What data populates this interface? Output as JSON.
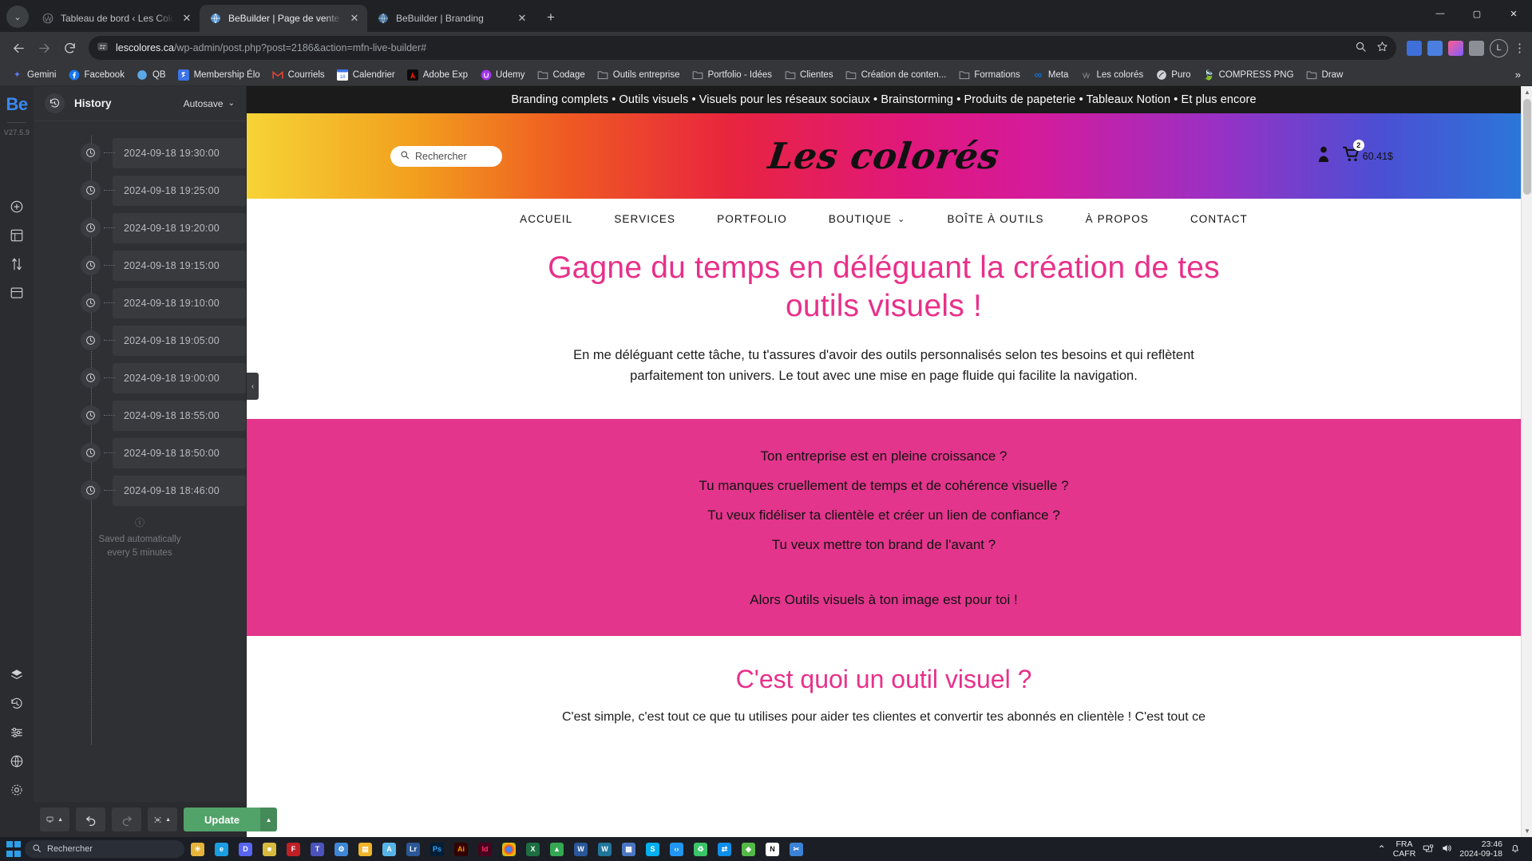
{
  "browser": {
    "tabs": [
      {
        "title": "Tableau de bord ‹ Les Colorés –",
        "favicon": "wordpress-icon",
        "active": false
      },
      {
        "title": "BeBuilder | Page de vente – Out",
        "favicon": "globe-icon",
        "active": true
      },
      {
        "title": "BeBuilder | Branding",
        "favicon": "globe-icon",
        "active": false
      }
    ],
    "newtab_label": "+",
    "tabdrop_label": "⌄",
    "window_controls": {
      "minimize": "—",
      "maximize": "▢",
      "close": "✕"
    },
    "nav": {
      "back": "←",
      "forward": "→",
      "reload": "⟳"
    },
    "omnibox": {
      "url_main": "lescolores.ca",
      "url_rest": "/wp-admin/post.php?post=2186&action=mfn-live-builder#",
      "site_info_icon": "page-settings-icon",
      "zoom_icon": "search-icon",
      "bookmark_icon": "star-icon"
    },
    "profile_initial": "L",
    "menu_icon": "⋮",
    "bookmarks": [
      {
        "label": "Gemini",
        "icon": "gemini-icon",
        "color": "#5b7cf5"
      },
      {
        "label": "Facebook",
        "icon": "facebook-icon",
        "color": "#1877f2"
      },
      {
        "label": "QB",
        "icon": "quickbooks-icon",
        "color": "#4da3e8"
      },
      {
        "label": "Membership Élo",
        "icon": "app-icon",
        "color": "#3b73e8"
      },
      {
        "label": "Courriels",
        "icon": "gmail-icon",
        "color": "#ea4335"
      },
      {
        "label": "Calendrier",
        "icon": "calendar-icon",
        "color": "#3b73e8"
      },
      {
        "label": "Adobe Exp",
        "icon": "adobe-icon",
        "color": "#fa0f00"
      },
      {
        "label": "Udemy",
        "icon": "udemy-icon",
        "color": "#a435f0"
      },
      {
        "label": "Codage",
        "icon": "folder-icon",
        "color": "#9aa0a6"
      },
      {
        "label": "Outils entreprise",
        "icon": "folder-icon",
        "color": "#9aa0a6"
      },
      {
        "label": "Portfolio - Idées",
        "icon": "folder-icon",
        "color": "#9aa0a6"
      },
      {
        "label": "Clientes",
        "icon": "folder-icon",
        "color": "#9aa0a6"
      },
      {
        "label": "Création de conten...",
        "icon": "folder-icon",
        "color": "#9aa0a6"
      },
      {
        "label": "Formations",
        "icon": "folder-icon",
        "color": "#9aa0a6"
      },
      {
        "label": "Meta",
        "icon": "meta-icon",
        "color": "#0082fb"
      },
      {
        "label": "Les colorés",
        "icon": "wordpress-icon",
        "color": "#8a8d91"
      },
      {
        "label": "Puro",
        "icon": "puro-icon",
        "color": "#cfd2d6"
      },
      {
        "label": "COMPRESS PNG",
        "icon": "tinypng-icon",
        "color": "#5ab9a8"
      },
      {
        "label": "Draw",
        "icon": "folder-icon",
        "color": "#9aa0a6"
      }
    ],
    "bookmarks_overflow": "»"
  },
  "builder": {
    "logo": "Be",
    "version": "V27.5.9",
    "rail_icons_mid": [
      "add-circle-icon",
      "grid-add-icon",
      "sort-updown-icon",
      "template-icon"
    ],
    "rail_icons_bottom": [
      "layers-icon",
      "history-icon",
      "sliders-icon",
      "globe-icon",
      "gear-icon",
      "wordpress-icon"
    ],
    "history": {
      "title": "History",
      "head_icon": "history-rotate-icon",
      "autosave_label": "Autosave",
      "autosave_caret": "⌄",
      "entries": [
        "2024-09-18 19:30:00",
        "2024-09-18 19:25:00",
        "2024-09-18 19:20:00",
        "2024-09-18 19:15:00",
        "2024-09-18 19:10:00",
        "2024-09-18 19:05:00",
        "2024-09-18 19:00:00",
        "2024-09-18 18:55:00",
        "2024-09-18 18:50:00",
        "2024-09-18 18:46:00"
      ],
      "footer_icon": "info-icon",
      "footer_line1": "Saved automatically",
      "footer_line2": "every 5 minutes"
    },
    "collapse_handle": "‹",
    "bottombar": {
      "responsive_icon": "monitor-icon",
      "responsive_caret": "▲",
      "undo_icon": "undo-icon",
      "redo_icon": "redo-icon",
      "preview_icon": "preview-eye-icon",
      "preview_caret": "▲",
      "update_label": "Update",
      "update_caret": "▲",
      "update_color": "#52a36a"
    }
  },
  "site": {
    "promo_bar": "Branding complets • Outils visuels • Visuels pour les réseaux sociaux • Brainstorming • Produits de papeterie • Tableaux Notion • Et plus encore",
    "search_placeholder": "Rechercher",
    "search_icon": "search-icon",
    "brand": "Les colorés",
    "account_icon": "user-icon",
    "cart_icon": "cart-icon",
    "cart_count": "2",
    "cart_total": "60.41$",
    "nav": [
      {
        "label": "ACCUEIL",
        "caret": ""
      },
      {
        "label": "SERVICES",
        "caret": ""
      },
      {
        "label": "PORTFOLIO",
        "caret": ""
      },
      {
        "label": "BOUTIQUE",
        "caret": "⌄"
      },
      {
        "label": "BOÎTE À OUTILS",
        "caret": ""
      },
      {
        "label": "À PROPOS",
        "caret": ""
      },
      {
        "label": "CONTACT",
        "caret": ""
      }
    ],
    "hero_heading": "Gagne du temps en déléguant la création de tes outils visuels !",
    "hero_paragraph": "En me déléguant cette tâche, tu t'assures d'avoir des outils personnalisés selon tes besoins et qui reflètent parfaitement ton univers. Le tout avec une mise en page fluide qui facilite la navigation.",
    "pink_section": {
      "background": "#e3358c",
      "questions": [
        "Ton entreprise est en pleine croissance ?",
        "Tu manques cruellement de temps et de cohérence visuelle ?",
        "Tu veux fidéliser ta clientèle et créer un lien de confiance ?",
        "Tu veux mettre ton brand de l'avant ?"
      ],
      "closing": "Alors Outils visuels à ton image est pour toi !"
    },
    "section2_heading": "C'est quoi un outil visuel ?",
    "section2_paragraph": "C'est simple, c'est tout ce que tu utilises pour aider tes clientes et convertir tes abonnés en clientèle ! C'est tout ce",
    "accent_pink": "#e8308a"
  },
  "taskbar": {
    "search_placeholder": "Rechercher",
    "search_icon": "search-icon",
    "start_icon": "windows-icon",
    "apps": [
      {
        "name": "weather-widget",
        "color": "#e6b33c",
        "glyph": "☀"
      },
      {
        "name": "edge-icon",
        "color": "#1b9de2",
        "glyph": "e"
      },
      {
        "name": "discord-icon",
        "color": "#5865f2",
        "glyph": "D"
      },
      {
        "name": "libreoffice-icon",
        "color": "#d8ba3e",
        "glyph": "■"
      },
      {
        "name": "filezilla-icon",
        "color": "#bf2026",
        "glyph": "F"
      },
      {
        "name": "teams-icon",
        "color": "#4b53bc",
        "glyph": "T"
      },
      {
        "name": "settings-icon",
        "color": "#3f87d6",
        "glyph": "⚙"
      },
      {
        "name": "explorer-icon",
        "color": "#f0b429",
        "glyph": "▤"
      },
      {
        "name": "acrobat-icon",
        "color": "#57b4e8",
        "glyph": "A"
      },
      {
        "name": "lightroom-icon",
        "color": "#2b5797",
        "glyph": "Lr"
      },
      {
        "name": "photoshop-icon",
        "color": "#001e36",
        "glyph": "Ps"
      },
      {
        "name": "illustrator-icon",
        "color": "#330000",
        "glyph": "Ai"
      },
      {
        "name": "indesign-icon",
        "color": "#49021f",
        "glyph": "Id"
      },
      {
        "name": "chrome-icon",
        "color": "#f2b705",
        "glyph": "◉"
      },
      {
        "name": "excel-icon",
        "color": "#1d6f42",
        "glyph": "X"
      },
      {
        "name": "drive-icon",
        "color": "#34a853",
        "glyph": "▲"
      },
      {
        "name": "word-icon",
        "color": "#2b579a",
        "glyph": "W"
      },
      {
        "name": "wordpress-icon",
        "color": "#21759b",
        "glyph": "W"
      },
      {
        "name": "calculator-icon",
        "color": "#4b76c4",
        "glyph": "▦"
      },
      {
        "name": "skype-icon",
        "color": "#00aff0",
        "glyph": "S"
      },
      {
        "name": "vscode-icon",
        "color": "#2196f3",
        "glyph": "‹›"
      },
      {
        "name": "recycle-icon",
        "color": "#3ac569",
        "glyph": "♻"
      },
      {
        "name": "teamviewer-icon",
        "color": "#0e8ee9",
        "glyph": "⇄"
      },
      {
        "name": "app-green-icon",
        "color": "#54b948",
        "glyph": "◆"
      },
      {
        "name": "notion-icon",
        "color": "#ffffff",
        "glyph": "N"
      },
      {
        "name": "snip-icon",
        "color": "#3b82d6",
        "glyph": "✂"
      }
    ],
    "tray": {
      "chevron": "⌃",
      "lang_line1": "FRA",
      "lang_line2": "CAFR",
      "network_icon": "network-icon",
      "volume_icon": "volume-icon",
      "time": "23:46",
      "date": "2024-09-18",
      "notification_icon": "bell-sleep-icon"
    }
  }
}
